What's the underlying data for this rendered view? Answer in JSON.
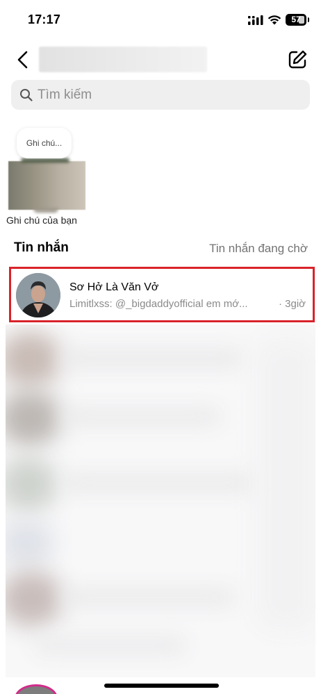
{
  "status_bar": {
    "time": "17:17",
    "battery": "57",
    "icons": [
      "signal-icon",
      "wifi-icon",
      "battery-icon"
    ]
  },
  "header": {
    "icons": [
      "back-icon",
      "compose-icon"
    ]
  },
  "search": {
    "placeholder": "Tìm kiếm",
    "icon": "search-icon"
  },
  "notes": {
    "bubble_text": "Ghi chú...",
    "label": "Ghi chú của bạn"
  },
  "messages": {
    "title": "Tin nhắn",
    "requests_label": "Tin nhắn đang chờ",
    "highlight_color": "#d9222a",
    "conversations": [
      {
        "name": "Sơ Hở Là Văn Vở",
        "preview": "Limitlxss: @_bigdaddyofficial em mớ...",
        "time": "· 3giờ"
      }
    ]
  },
  "colors": {
    "accent_story_ring": "#d12c8a",
    "secondary_text": "#8a8a8a"
  }
}
